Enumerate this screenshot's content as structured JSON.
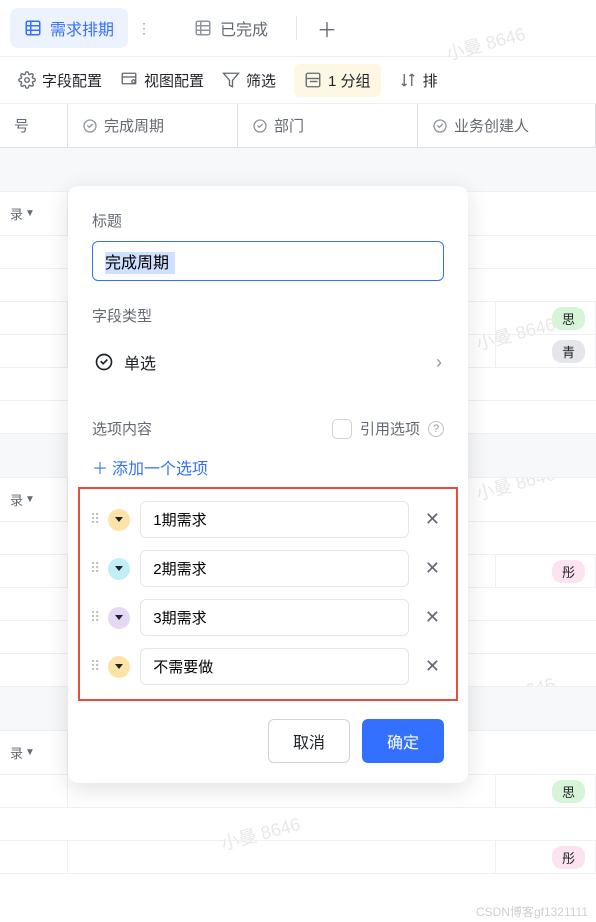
{
  "watermark": "小曼 8646",
  "csdn": "CSDN博客gf1321111",
  "tabs": {
    "active": {
      "label": "需求排期"
    },
    "done": {
      "label": "已完成"
    }
  },
  "toolbar": {
    "fieldConfig": "字段配置",
    "viewConfig": "视图配置",
    "filter": "筛选",
    "group": "1 分组",
    "sort": "排"
  },
  "columns": {
    "seq": "号",
    "cycle": "完成周期",
    "dept": "部门",
    "creator": "业务创建人"
  },
  "rows": {
    "recordLabel": "录",
    "badges": [
      "思",
      "青",
      "彤",
      "思",
      "彤"
    ]
  },
  "popover": {
    "titleLabel": "标题",
    "titleValue": "完成周期",
    "fieldTypeLabel": "字段类型",
    "fieldTypeValue": "单选",
    "optionsLabel": "选项内容",
    "refLabel": "引用选项",
    "addOption": "添加一个选项",
    "options": [
      {
        "label": "1期需求",
        "color": "#fde3a7"
      },
      {
        "label": "2期需求",
        "color": "#c1eef7"
      },
      {
        "label": "3期需求",
        "color": "#e5d8f5"
      },
      {
        "label": "不需要做",
        "color": "#fde3a7"
      }
    ],
    "cancel": "取消",
    "confirm": "确定"
  }
}
